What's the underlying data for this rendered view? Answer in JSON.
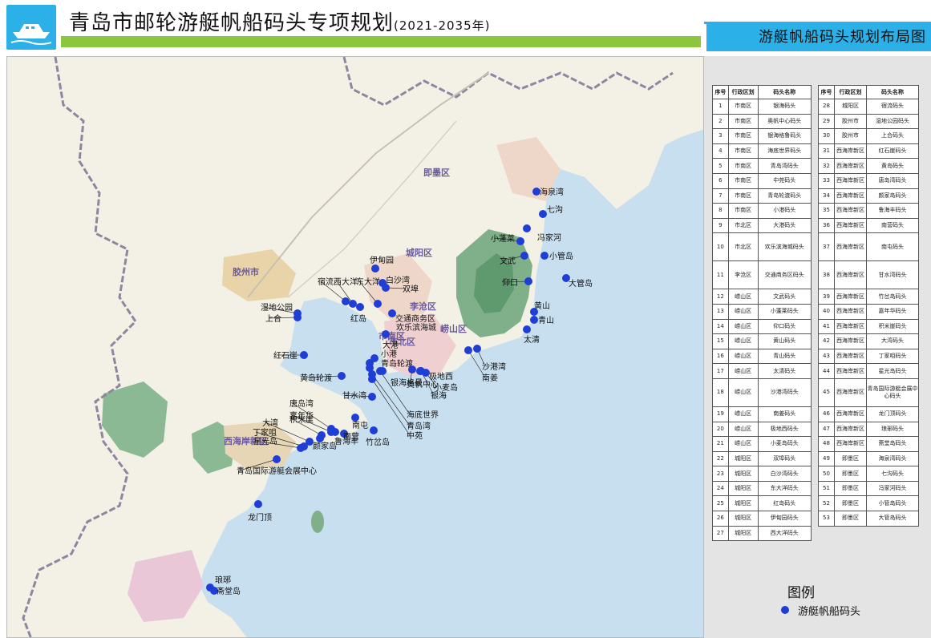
{
  "header": {
    "title": "青岛市邮轮游艇帆船码头专项规划",
    "period": "(2021-2035年)",
    "map_title": "游艇帆船码头规划布局图"
  },
  "table_headers": {
    "no": "序号",
    "district": "行政区划",
    "name": "码头名称"
  },
  "table_left": [
    {
      "no": "1",
      "district": "市南区",
      "name": "银海码头"
    },
    {
      "no": "2",
      "district": "市南区",
      "name": "奥帆中心码头"
    },
    {
      "no": "3",
      "district": "市南区",
      "name": "银海格鲁码头"
    },
    {
      "no": "4",
      "district": "市南区",
      "name": "海底世界码头"
    },
    {
      "no": "5",
      "district": "市南区",
      "name": "青岛湾码头"
    },
    {
      "no": "6",
      "district": "市南区",
      "name": "中苑码头"
    },
    {
      "no": "7",
      "district": "市南区",
      "name": "青岛轮渡码头"
    },
    {
      "no": "8",
      "district": "市南区",
      "name": "小港码头"
    },
    {
      "no": "9",
      "district": "市北区",
      "name": "大港码头"
    },
    {
      "no": "10",
      "district": "市北区",
      "name": "欢乐滨海城码头"
    },
    {
      "no": "11",
      "district": "李沧区",
      "name": "交通商务区码头"
    },
    {
      "no": "12",
      "district": "崂山区",
      "name": "文武码头"
    },
    {
      "no": "13",
      "district": "崂山区",
      "name": "小蓬莱码头"
    },
    {
      "no": "14",
      "district": "崂山区",
      "name": "仰口码头"
    },
    {
      "no": "15",
      "district": "崂山区",
      "name": "黄山码头"
    },
    {
      "no": "16",
      "district": "崂山区",
      "name": "青山码头"
    },
    {
      "no": "17",
      "district": "崂山区",
      "name": "太清码头"
    },
    {
      "no": "18",
      "district": "崂山区",
      "name": "沙港湾码头"
    },
    {
      "no": "19",
      "district": "崂山区",
      "name": "南姜码头"
    },
    {
      "no": "20",
      "district": "崂山区",
      "name": "极地西码头"
    },
    {
      "no": "21",
      "district": "崂山区",
      "name": "小麦岛码头"
    },
    {
      "no": "22",
      "district": "城阳区",
      "name": "双埠码头"
    },
    {
      "no": "23",
      "district": "城阳区",
      "name": "白沙湾码头"
    },
    {
      "no": "24",
      "district": "城阳区",
      "name": "东大洋码头"
    },
    {
      "no": "25",
      "district": "城阳区",
      "name": "红岛码头"
    },
    {
      "no": "26",
      "district": "城阳区",
      "name": "伊甸园码头"
    },
    {
      "no": "27",
      "district": "城阳区",
      "name": "西大洋码头"
    }
  ],
  "table_right": [
    {
      "no": "28",
      "district": "城阳区",
      "name": "宿流码头"
    },
    {
      "no": "29",
      "district": "胶州市",
      "name": "湿地公园码头"
    },
    {
      "no": "30",
      "district": "胶州市",
      "name": "上合码头"
    },
    {
      "no": "31",
      "district": "西海岸新区",
      "name": "红石崖码头"
    },
    {
      "no": "32",
      "district": "西海岸新区",
      "name": "黄岛码头"
    },
    {
      "no": "33",
      "district": "西海岸新区",
      "name": "唐岛湾码头"
    },
    {
      "no": "34",
      "district": "西海岸新区",
      "name": "颜家岛码头"
    },
    {
      "no": "35",
      "district": "西海岸新区",
      "name": "鲁海丰码头"
    },
    {
      "no": "36",
      "district": "西海岸新区",
      "name": "南营码头"
    },
    {
      "no": "37",
      "district": "西海岸新区",
      "name": "南屯码头"
    },
    {
      "no": "38",
      "district": "西海岸新区",
      "name": "甘水湾码头"
    },
    {
      "no": "39",
      "district": "西海岸新区",
      "name": "竹岔岛码头"
    },
    {
      "no": "40",
      "district": "西海岸新区",
      "name": "嘉年华码头"
    },
    {
      "no": "41",
      "district": "西海岸新区",
      "name": "积米崖码头"
    },
    {
      "no": "42",
      "district": "西海岸新区",
      "name": "大湾码头"
    },
    {
      "no": "43",
      "district": "西海岸新区",
      "name": "丁家咀码头"
    },
    {
      "no": "44",
      "district": "西海岸新区",
      "name": "星光岛码头"
    },
    {
      "no": "45",
      "district": "西海岸新区",
      "name": "青岛国际游艇会展中心码头"
    },
    {
      "no": "46",
      "district": "西海岸新区",
      "name": "龙门顶码头"
    },
    {
      "no": "47",
      "district": "西海岸新区",
      "name": "琅琊码头"
    },
    {
      "no": "48",
      "district": "西海岸新区",
      "name": "斋堂岛码头"
    },
    {
      "no": "49",
      "district": "即墨区",
      "name": "海泉湾码头"
    },
    {
      "no": "50",
      "district": "即墨区",
      "name": "七沟码头"
    },
    {
      "no": "51",
      "district": "即墨区",
      "name": "冯家河码头"
    },
    {
      "no": "52",
      "district": "即墨区",
      "name": "小管岛码头"
    },
    {
      "no": "53",
      "district": "即墨区",
      "name": "大管岛码头"
    }
  ],
  "legend": {
    "title": "图例",
    "item": "游艇帆船码头",
    "dot_color": "#1f3ed6"
  },
  "map": {
    "districts": [
      "即墨区",
      "胶州市",
      "城阳区",
      "李沧区",
      "崂山区",
      "市北区",
      "市南区",
      "西海岸新区"
    ],
    "labels": [
      "海泉湾",
      "七沟",
      "小蓬莱",
      "冯家河",
      "小管岛",
      "文武",
      "仰口",
      "大管岛",
      "黄山",
      "青山",
      "太清",
      "沙港湾",
      "南姜",
      "极地西",
      "小麦岛",
      "银海",
      "伊甸园",
      "东大洋",
      "西大洋",
      "宿流",
      "白沙湾",
      "双埠",
      "红岛",
      "湿地公园",
      "上合",
      "交通商务区",
      "欢乐滨海城",
      "大港",
      "小港",
      "青岛轮渡",
      "银海格曼",
      "奥帆中心",
      "海底世界",
      "青岛湾",
      "中苑",
      "红石崖",
      "黄岛轮渡",
      "甘水湾",
      "唐岛湾",
      "嘉年华",
      "积米崖",
      "大湾",
      "丁家咀",
      "星光岛",
      "南屯",
      "南营",
      "鲁海丰",
      "颜家岛",
      "竹岔岛",
      "青岛国际游艇会展中心",
      "龙门顶",
      "琅琊",
      "斋堂岛"
    ]
  }
}
